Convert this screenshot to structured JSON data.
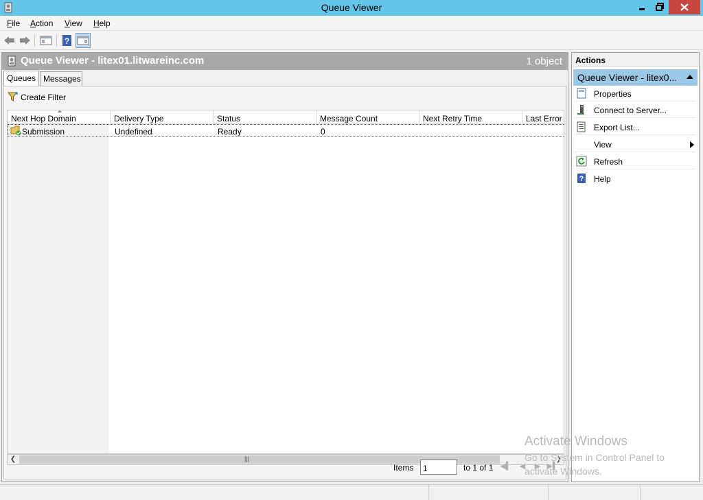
{
  "window": {
    "title": "Queue Viewer"
  },
  "menu": [
    {
      "label": "File",
      "accel": "F"
    },
    {
      "label": "Action",
      "accel": "A"
    },
    {
      "label": "View",
      "accel": "V"
    },
    {
      "label": "Help",
      "accel": "H"
    }
  ],
  "toolbar": [
    "back-arrow-icon",
    "forward-arrow-icon",
    "show-hide-console-tree-icon",
    "help-icon",
    "show-hide-action-pane-icon"
  ],
  "header": {
    "title": "Queue Viewer - litex01.litwareinc.com",
    "count": "1 object"
  },
  "tabs": [
    {
      "label": "Queues",
      "active": true
    },
    {
      "label": "Messages",
      "active": false
    }
  ],
  "filter": {
    "label": "Create Filter"
  },
  "table": {
    "columns": [
      "Next Hop Domain",
      "Delivery Type",
      "Status",
      "Message Count",
      "Next Retry Time",
      "Last Error"
    ],
    "rows": [
      [
        "Submission",
        "Undefined",
        "Ready",
        "0",
        "",
        ""
      ]
    ]
  },
  "pager": {
    "items_label": "Items",
    "items_value": "1",
    "range_label": "to 1 of 1"
  },
  "actions": {
    "title": "Actions",
    "subheader": "Queue Viewer - litex0...",
    "items": [
      {
        "label": "Properties",
        "icon": "properties-icon"
      },
      {
        "label": "Connect to Server...",
        "icon": "connect-server-icon"
      },
      {
        "label": "Export List...",
        "icon": "export-list-icon"
      },
      {
        "label": "View",
        "icon": "",
        "submenu": true
      },
      {
        "label": "Refresh",
        "icon": "refresh-icon"
      },
      {
        "label": "Help",
        "icon": "help-icon"
      }
    ]
  },
  "watermark": {
    "line1": "Activate Windows",
    "line2": "Go to System in Control Panel to",
    "line3": "activate Windows."
  },
  "colors": {
    "titlebar": "#63c6e9",
    "close": "#c7463f",
    "header": "#a9a9a9",
    "action_highlight": "#9cc8e8"
  }
}
